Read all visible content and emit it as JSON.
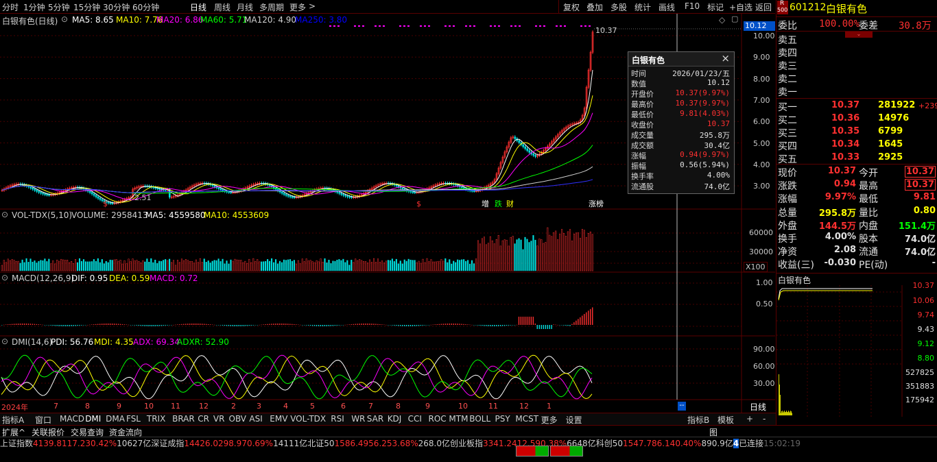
{
  "toolbar": {
    "periods": [
      "分时",
      "1分钟",
      "5分钟",
      "15分钟",
      "30分钟",
      "60分钟",
      "日线",
      "周线",
      "月线",
      "多周期",
      "更多"
    ],
    "selected_period": "日线",
    "more_arrow": ">",
    "right_buttons": [
      "复权",
      "叠加",
      "多股",
      "统计",
      "画线",
      "F10",
      "标记",
      "+自选",
      "返回"
    ]
  },
  "main": {
    "title": "白银有色(日线)",
    "ma_labels": [
      {
        "text": "MA5: 8.65",
        "color": "#ffffff"
      },
      {
        "text": "MA10: 7.76",
        "color": "#ffff00"
      },
      {
        "text": "MA20: 6.86",
        "color": "#ff00ff"
      },
      {
        "text": "MA60: 5.71",
        "color": "#00ff00"
      },
      {
        "text": "MA120: 4.90",
        "color": "#d0d0d0"
      },
      {
        "text": "MA250: 3.80",
        "color": "#0000ff"
      }
    ],
    "price_axis": [
      "10.00",
      "9.00",
      "8.00",
      "7.00",
      "6.00",
      "5.00",
      "4.00",
      "3.00"
    ],
    "cursor_price": "10.12",
    "high_label": "10.37",
    "low_label": "2.51",
    "event_markers": [
      {
        "text": "$",
        "color": "#ff3030"
      },
      {
        "text": "$",
        "color": "#ff3030"
      },
      {
        "text": "增",
        "color": "#ffffff"
      },
      {
        "text": "跌",
        "color": "#00ff00"
      },
      {
        "text": "财",
        "color": "#ffff00"
      },
      {
        "text": "涨榜",
        "color": "#ffffff"
      }
    ]
  },
  "volume": {
    "title": "VOL-TDX(5,10)",
    "volume": "VOLUME: 2958413",
    "ma5": "MA5: 4559580",
    "ma10": "MA10: 4553609",
    "axis": [
      "60000",
      "30000"
    ],
    "unit": "X100"
  },
  "macd": {
    "title": "MACD(12,26,9)",
    "dif": "DIF: 0.95",
    "dea": "DEA: 0.59",
    "macd": "MACD: 0.72",
    "axis": [
      "1.00",
      "0.50"
    ]
  },
  "dmi": {
    "title": "DMI(14,6)",
    "pdi": "PDI: 56.76",
    "mdi": "MDI: 4.35",
    "adx": "ADX: 69.34",
    "adxr": "ADXR: 52.90",
    "axis": [
      "90.00",
      "60.00",
      "30.00"
    ]
  },
  "xaxis": {
    "labels": [
      "2024年",
      "7",
      "8",
      "9",
      "10",
      "11",
      "12",
      "2",
      "3",
      "4",
      "5",
      "6",
      "7",
      "8",
      "9",
      "10",
      "11",
      "12",
      "1"
    ],
    "cursor_label": "--",
    "period_label": "日线"
  },
  "tooltip": {
    "title": "白银有色",
    "close": "×",
    "rows": [
      {
        "k": "时间",
        "v": "2026/01/23/五",
        "c": "#e0e0e0"
      },
      {
        "k": "数值",
        "v": "10.12",
        "c": "#e0e0e0"
      },
      {
        "k": "开盘价",
        "v": "10.37(9.97%)",
        "c": "#ff3030"
      },
      {
        "k": "最高价",
        "v": "10.37(9.97%)",
        "c": "#ff3030"
      },
      {
        "k": "最低价",
        "v": "9.81(4.03%)",
        "c": "#ff3030"
      },
      {
        "k": "收盘价",
        "v": "10.37",
        "c": "#ff3030"
      },
      {
        "k": "成交量",
        "v": "295.8万",
        "c": "#e0e0e0"
      },
      {
        "k": "成交额",
        "v": "30.4亿",
        "c": "#e0e0e0"
      },
      {
        "k": "涨幅",
        "v": "0.94(9.97%)",
        "c": "#ff3030"
      },
      {
        "k": "振幅",
        "v": "0.56(5.94%)",
        "c": "#e0e0e0"
      },
      {
        "k": "换手率",
        "v": "4.00%",
        "c": "#e0e0e0"
      },
      {
        "k": "流通股",
        "v": "74.0亿",
        "c": "#e0e0e0"
      }
    ]
  },
  "quote": {
    "badge_top": "R",
    "badge_bottom": "500",
    "code": "601212",
    "name": "白银有色",
    "weibi_label": "委比",
    "weibi": "100.00%",
    "weicha_label": "委差",
    "weicha": "30.8万",
    "sells": [
      "卖五",
      "卖四",
      "卖三",
      "卖二",
      "卖一"
    ],
    "buys": [
      {
        "label": "买一",
        "price": "10.37",
        "vol": "281922",
        "chg": "+239"
      },
      {
        "label": "买二",
        "price": "10.36",
        "vol": "14976",
        "chg": ""
      },
      {
        "label": "买三",
        "price": "10.35",
        "vol": "6799",
        "chg": ""
      },
      {
        "label": "买四",
        "price": "10.34",
        "vol": "1645",
        "chg": ""
      },
      {
        "label": "买五",
        "price": "10.33",
        "vol": "2925",
        "chg": ""
      }
    ],
    "stats": [
      {
        "l1": "现价",
        "v1": "10.37",
        "c1": "#ff3030",
        "l2": "今开",
        "v2": "10.37",
        "c2": "#ff3030",
        "box2": true
      },
      {
        "l1": "涨跌",
        "v1": "0.94",
        "c1": "#ff3030",
        "l2": "最高",
        "v2": "10.37",
        "c2": "#ff3030",
        "box2": true
      },
      {
        "l1": "涨幅",
        "v1": "9.97%",
        "c1": "#ff3030",
        "l2": "最低",
        "v2": "9.81",
        "c2": "#ff3030",
        "box2": false
      },
      {
        "l1": "总量",
        "v1": "295.8万",
        "c1": "#ffff00",
        "l2": "量比",
        "v2": "0.80",
        "c2": "#ffff00",
        "box2": false
      },
      {
        "l1": "外盘",
        "v1": "144.5万",
        "c1": "#ff3030",
        "l2": "内盘",
        "v2": "151.4万",
        "c2": "#00ff00",
        "box2": false
      },
      {
        "l1": "换手",
        "v1": "4.00%",
        "c1": "#e0e0e0",
        "l2": "股本",
        "v2": "74.0亿",
        "c2": "#e0e0e0",
        "box2": false
      },
      {
        "l1": "净资",
        "v1": "2.08",
        "c1": "#e0e0e0",
        "l2": "流通",
        "v2": "74.0亿",
        "c2": "#e0e0e0",
        "box2": false
      },
      {
        "l1": "收益(三)",
        "v1": "-0.030",
        "c1": "#e0e0e0",
        "l2": "PE(动)",
        "v2": "-",
        "c2": "#e0e0e0",
        "box2": false
      }
    ],
    "mini_title": "白银有色",
    "mini_axis": [
      {
        "v": "10.37",
        "c": "#ff3030"
      },
      {
        "v": "10.06",
        "c": "#ff3030"
      },
      {
        "v": "9.74",
        "c": "#ff3030"
      },
      {
        "v": "9.43",
        "c": "#e0e0e0"
      },
      {
        "v": "9.12",
        "c": "#00ff00"
      },
      {
        "v": "8.80",
        "c": "#00ff00"
      },
      {
        "v": "527825",
        "c": "#e0e0e0"
      },
      {
        "v": "351883",
        "c": "#e0e0e0"
      },
      {
        "v": "175942",
        "c": "#e0e0e0"
      }
    ]
  },
  "indicator_tabs": [
    "指标A",
    "窗口",
    "MACD",
    "DMI",
    "DMA",
    "FSL",
    "TRIX",
    "BRAR",
    "CR",
    "VR",
    "OBV",
    "ASI",
    "EMV",
    "VOL-TDX",
    "RSI",
    "WR",
    "SAR",
    "KDJ",
    "CCI",
    "ROC",
    "MTM",
    "BOLL",
    "PSY",
    "MCST",
    "更多",
    "设置"
  ],
  "indicator_right": [
    "指标B",
    "模板",
    "+",
    "-"
  ],
  "ext_tabs": [
    "扩展^",
    "关联报价",
    "交易查询",
    "资金流向"
  ],
  "ext_right": "图",
  "status": {
    "indices": [
      {
        "name": "上证指数",
        "value": "4139.81",
        "chg": "17.23",
        "pct": "0.42%",
        "amt": "10627亿"
      },
      {
        "name": "深证成指",
        "value": "14426.02",
        "chg": "98.97",
        "pct": "0.69%",
        "amt": "14111亿"
      },
      {
        "name": "北证50",
        "value": "1586.49",
        "chg": "56.25",
        "pct": "3.68%",
        "amt": "268.0亿"
      },
      {
        "name": "创业板指",
        "value": "3341.24",
        "chg": "12.59",
        "pct": "0.38%",
        "amt": "6648亿"
      },
      {
        "name": "科创50",
        "value": "1547.78",
        "chg": "6.14",
        "pct": "0.40%",
        "amt": "890.9亿"
      }
    ],
    "badge": "4",
    "connected": "已连接",
    "time_partial": "15:02:19"
  },
  "colors": {
    "up": "#ff3030",
    "down": "#00ff00",
    "grid": "#5a0000",
    "accent": "#0050c8"
  }
}
